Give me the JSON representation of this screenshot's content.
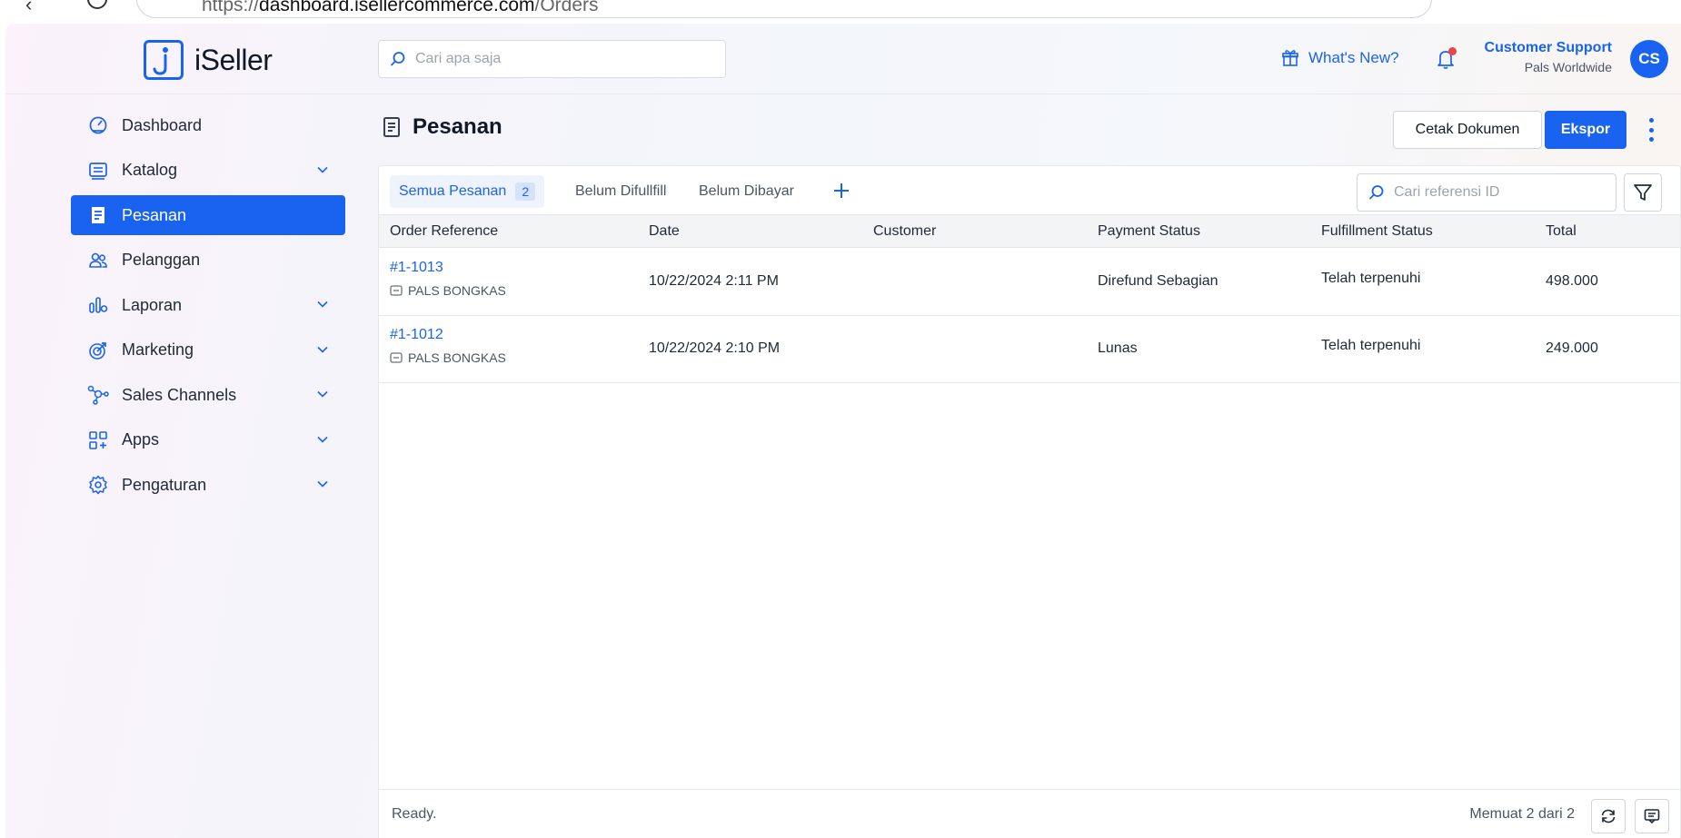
{
  "browser": {
    "url_scheme": "https://",
    "url_host": "dashboard.isellercommerce.com",
    "url_path": "/Orders"
  },
  "app": {
    "brand": "iSeller",
    "search_placeholder": "Cari apa saja",
    "whats_new_label": "What's New?",
    "user": {
      "name": "Customer Support",
      "org": "Pals Worldwide",
      "initials": "CS"
    },
    "accent_color": "#1a63f0"
  },
  "sidebar": {
    "items": [
      {
        "label": "Dashboard",
        "icon": "dashboard-icon",
        "has_children": false
      },
      {
        "label": "Katalog",
        "icon": "catalog-icon",
        "has_children": true
      },
      {
        "label": "Pesanan",
        "icon": "orders-icon",
        "has_children": false,
        "active": true
      },
      {
        "label": "Pelanggan",
        "icon": "customers-icon",
        "has_children": false
      },
      {
        "label": "Laporan",
        "icon": "reports-icon",
        "has_children": true
      },
      {
        "label": "Marketing",
        "icon": "marketing-icon",
        "has_children": true
      },
      {
        "label": "Sales Channels",
        "icon": "sales-channels-icon",
        "has_children": true
      },
      {
        "label": "Apps",
        "icon": "apps-icon",
        "has_children": true
      },
      {
        "label": "Pengaturan",
        "icon": "settings-icon",
        "has_children": true
      }
    ]
  },
  "page": {
    "title": "Pesanan",
    "print_button": "Cetak Dokumen",
    "export_button": "Ekspor"
  },
  "tabs": {
    "all": {
      "label": "Semua Pesanan",
      "count": "2"
    },
    "unfulfilled": {
      "label": "Belum Difullfill"
    },
    "unpaid": {
      "label": "Belum Dibayar"
    },
    "ref_search_placeholder": "Cari referensi ID"
  },
  "table": {
    "columns": [
      "Order Reference",
      "Date",
      "Customer",
      "Payment Status",
      "Fulfillment Status",
      "Total"
    ],
    "rows": [
      {
        "ref": "#1-1013",
        "store": "PALS BONGKAS",
        "date": "10/22/2024 2:11 PM",
        "customer": "",
        "payment": "Direfund Sebagian",
        "fulfillment": "Telah terpenuhi",
        "total": "498.000"
      },
      {
        "ref": "#1-1012",
        "store": "PALS BONGKAS",
        "date": "10/22/2024 2:10 PM",
        "customer": "",
        "payment": "Lunas",
        "fulfillment": "Telah terpenuhi",
        "total": "249.000"
      }
    ]
  },
  "footer": {
    "status": "Ready.",
    "loaded": "Memuat 2 dari 2"
  }
}
